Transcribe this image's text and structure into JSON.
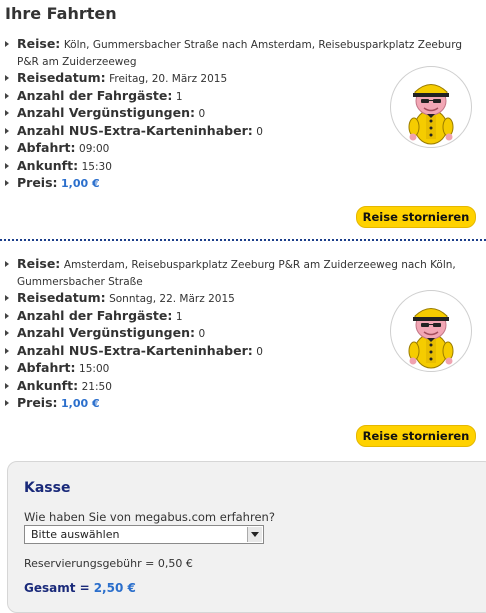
{
  "header": {
    "title": "Ihre Fahrten"
  },
  "trips": [
    {
      "route_label": "Reise:",
      "route": "Köln, Gummersbacher Straße nach Amsterdam, Reisebusparkplatz Zeeburg P&R am Zuiderzeeweg",
      "date_label": "Reisedatum:",
      "date": "Freitag, 20. März 2015",
      "passengers_label": "Anzahl der Fahrgäste:",
      "passengers": "1",
      "discounts_label": "Anzahl Vergünstigungen:",
      "discounts": "0",
      "nus_label": "Anzahl NUS-Extra-Karteninhaber:",
      "nus": "0",
      "departure_label": "Abfahrt:",
      "departure": "09:00",
      "arrival_label": "Ankunft:",
      "arrival": "15:30",
      "price_label": "Preis:",
      "price": "1,00 €",
      "cancel_label": "Reise stornieren",
      "avatar_icon": "megabus-driver-mascot-icon"
    },
    {
      "route_label": "Reise:",
      "route": "Amsterdam, Reisebusparkplatz Zeeburg P&R am Zuiderzeeweg nach Köln, Gummersbacher Straße",
      "date_label": "Reisedatum:",
      "date": "Sonntag, 22. März 2015",
      "passengers_label": "Anzahl der Fahrgäste:",
      "passengers": "1",
      "discounts_label": "Anzahl Vergünstigungen:",
      "discounts": "0",
      "nus_label": "Anzahl NUS-Extra-Karteninhaber:",
      "nus": "0",
      "departure_label": "Abfahrt:",
      "departure": "15:00",
      "arrival_label": "Ankunft:",
      "arrival": "21:50",
      "price_label": "Preis:",
      "price": "1,00 €",
      "cancel_label": "Reise stornieren",
      "avatar_icon": "megabus-driver-mascot-icon"
    }
  ],
  "checkout": {
    "title": "Kasse",
    "question": "Wie haben Sie von megabus.com erfahren?",
    "source_select": "Bitte auswählen",
    "fee": "Reservierungsgebühr = 0,50 €",
    "total_label": "Gesamt =",
    "total_amount": "2,50 €"
  },
  "colors": {
    "accent_yellow": "#ffd200",
    "heading_blue": "#1a2a7a",
    "price_blue": "#2b6fcc",
    "divider_blue": "#1c3f8c"
  }
}
